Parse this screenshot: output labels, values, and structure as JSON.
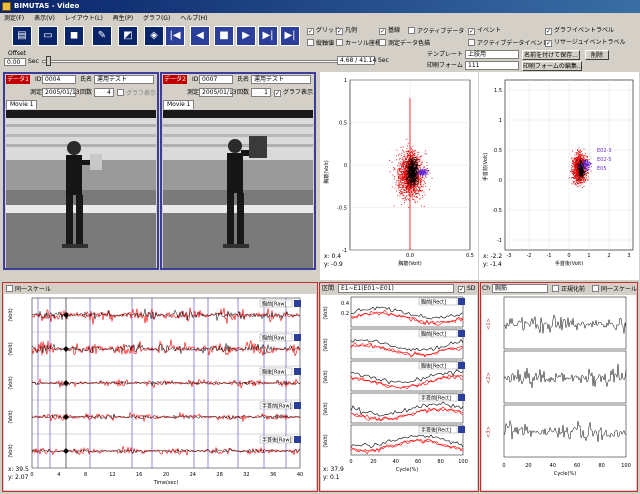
{
  "window": {
    "title": "BIMUTAS - Video"
  },
  "menu": [
    "測定(F)",
    "表示(V)",
    "レイアウト(L)",
    "再生(P)",
    "グラフ(G)",
    "ヘルプ(H)"
  ],
  "toolbar": {
    "icons": [
      "new-file-icon",
      "open-folder-icon",
      "save-icon",
      "edit-icon",
      "graph-icon",
      "export-icon"
    ],
    "nav": [
      "|◀",
      "◀",
      "■",
      "▶",
      "▶|",
      "▶|"
    ]
  },
  "options": {
    "grid": "グリッド",
    "legend": "凡例",
    "baseline": "基線",
    "active_data": "アクティブデータ",
    "event": "イベント",
    "graph_event_label": "グラフイベントラベル",
    "vertical_axis": "縦軸値",
    "cursor_coords": "カーソル座標",
    "measure_data_display": "測定データ色描",
    "active_event": "アクティブデータイベント",
    "lissajous_event_label": "リサージュイベントラベル"
  },
  "template": {
    "label": "テンプレート",
    "value": "上肢用",
    "save_button": "名前を付けて保存...",
    "delete_button": "削除",
    "print_form_label": "印刷フォーム",
    "print_form_value": "111",
    "print_edit_button": "印刷フォームの編集..."
  },
  "offset": {
    "label": "Offset",
    "value": "0.00",
    "unit": "Sec",
    "position": "4.68 / 41.14",
    "unit2": "Sec"
  },
  "subject_left": {
    "tag": "データ1",
    "id_label": "ID",
    "id": "0004",
    "name_label": "氏名",
    "name": "運用テスト",
    "date_label": "測定",
    "date": "2005/01/13",
    "count_label": "回数",
    "count": "4",
    "graph_display": "グラフ表示",
    "tab": "Movie 1"
  },
  "subject_right": {
    "tag": "データ2",
    "id_label": "ID",
    "id": "0007",
    "name_label": "氏名",
    "name": "運用テスト",
    "date_label": "測定",
    "date": "2005/01/13",
    "count_label": "回数",
    "count": "1",
    "graph_display": "グラフ表示",
    "tab": "Movie 1"
  },
  "scatter_left": {
    "ylabel": "胸筋(Volt)",
    "xlabel": "胸筋(Volt)",
    "ymax": "1",
    "yticks": [
      "1",
      "0.5",
      "0",
      "-0.5",
      "-1"
    ],
    "xticks": [
      "0.0",
      "0.5"
    ],
    "cursor_x": "0.4",
    "cursor_y": "-0.9"
  },
  "scatter_right": {
    "ylabel": "手首前(Volt)",
    "xlabel": "手首後(Volt)",
    "yticks": [
      "1.5",
      "1",
      "0.5",
      "0",
      "-0.5",
      "-1"
    ],
    "xticks": [
      "-3",
      "-2",
      "-1",
      "0",
      "1",
      "2",
      "3"
    ],
    "cursor_x": "-2.2",
    "cursor_y": "-1.4",
    "annotations": [
      "E02-3",
      "E02-5",
      "E05"
    ]
  },
  "waveform": {
    "same_scale": "同一スケール",
    "xlabel": "Time(sec)",
    "xticks": [
      "0",
      "4",
      "8",
      "12",
      "16",
      "20",
      "24",
      "28",
      "32",
      "36",
      "40"
    ],
    "channels": [
      "胸前[Raw]",
      "胸前[Raw]",
      "胸後[Raw]",
      "手首前[Raw]",
      "手首後[Raw]"
    ],
    "ylabel": "(Volt)",
    "cursor_x": "39.5",
    "cursor_y": "2.07"
  },
  "cycle": {
    "interval_label": "区間",
    "interval_value": "E1~E1(E01~E01)",
    "sd_label": "SD",
    "channels": [
      "胸前[Rect]",
      "胸前[Rect]",
      "胸後[Rect]",
      "手首前[Rect]",
      "手首後[Rect]"
    ],
    "xlabel": "Cycle(%)",
    "xticks": [
      "0",
      "20",
      "40",
      "60",
      "80",
      "100"
    ],
    "cursor_x": "37.9",
    "cursor_y": "0.1",
    "yticks": [
      "0.4",
      "0.2"
    ]
  },
  "right_panel": {
    "ch_label": "Ch",
    "ch_value": "胸筋",
    "normalize": "正規化前",
    "same_scale": "同一スケール",
    "row_labels": [
      "<1>",
      "<2>",
      "<3>"
    ],
    "xlabel": "Cycle(%)",
    "xticks": [
      "0",
      "20",
      "40",
      "60",
      "80",
      "100"
    ]
  },
  "colors": {
    "accent": "#0a246a",
    "red": "#ff0000",
    "blue": "#2a3e9a"
  }
}
